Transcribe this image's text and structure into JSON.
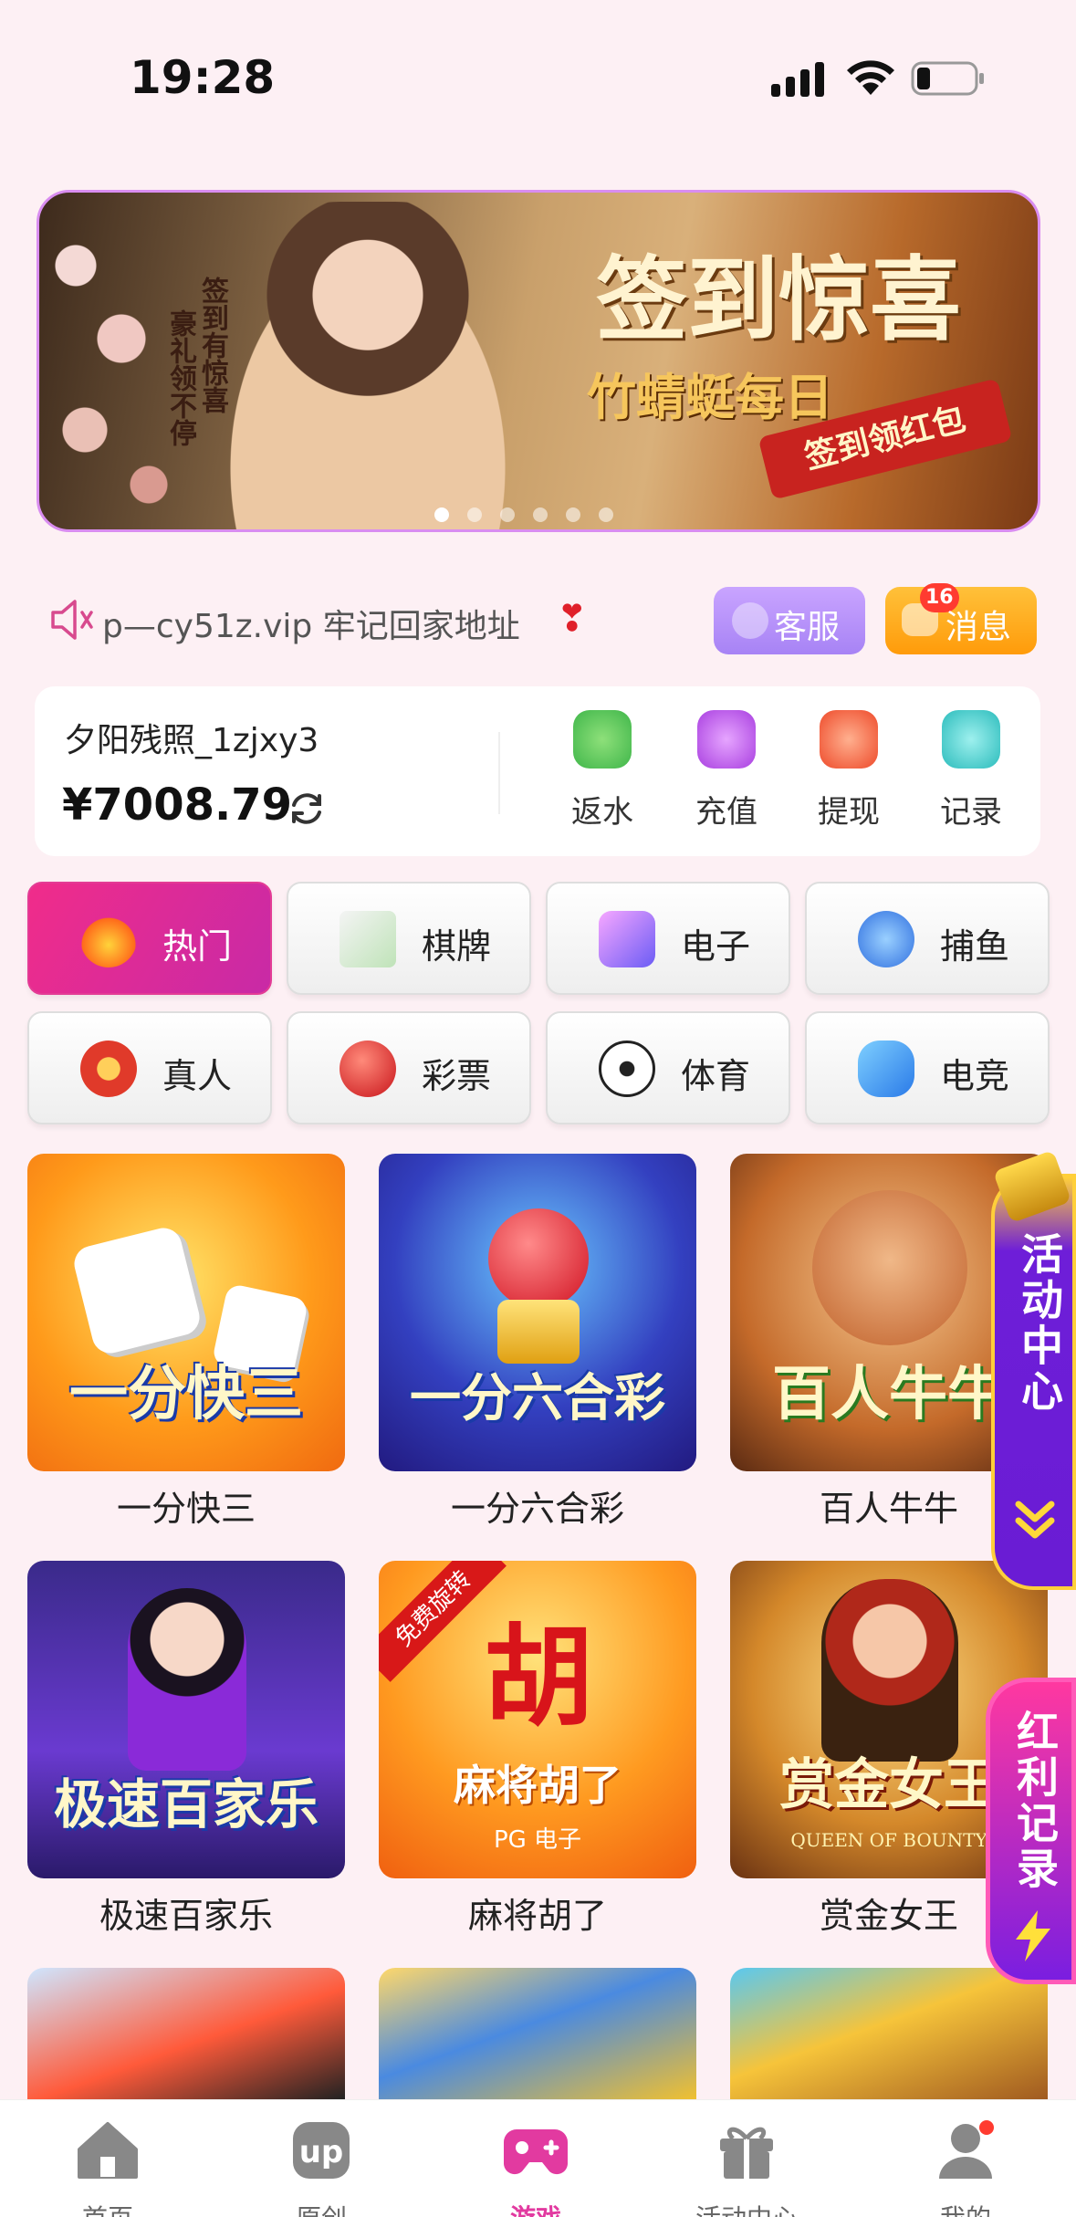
{
  "status_bar": {
    "time": "19:28"
  },
  "banner": {
    "headline": "签到惊喜",
    "subline": "竹蜻蜓每日",
    "ribbon": "签到领红包",
    "vertical_1": "签到有惊喜",
    "vertical_2": "豪礼领不停",
    "slides": 6,
    "active_slide": 1
  },
  "notice": {
    "text": "p—cy51z.vip 牢记回家地址",
    "icon": "speaker-icon"
  },
  "buttons": {
    "service": "客服",
    "messages": "消息",
    "message_badge": "16"
  },
  "account": {
    "username": "夕阳残照_1zjxy3",
    "balance": "¥7008.79",
    "actions": [
      {
        "label": "返水",
        "icon": "coins-icon",
        "color": "#4cc25a"
      },
      {
        "label": "充值",
        "icon": "money-bag-icon",
        "color": "#b44be6"
      },
      {
        "label": "提现",
        "icon": "wallet-icon",
        "color": "#f0522e"
      },
      {
        "label": "记录",
        "icon": "record-icon",
        "color": "#30c1c0"
      }
    ]
  },
  "categories": [
    {
      "label": "热门",
      "icon": "fire-icon",
      "active": true
    },
    {
      "label": "棋牌",
      "icon": "mahjong-icon",
      "active": false
    },
    {
      "label": "电子",
      "icon": "slot-icon",
      "active": false
    },
    {
      "label": "捕鱼",
      "icon": "fish-icon",
      "active": false
    },
    {
      "label": "真人",
      "icon": "chip-icon",
      "active": false
    },
    {
      "label": "彩票",
      "icon": "lottery-ball-icon",
      "active": false
    },
    {
      "label": "体育",
      "icon": "soccer-ball-icon",
      "active": false
    },
    {
      "label": "电竞",
      "icon": "gamepad-icon",
      "active": false
    }
  ],
  "games": [
    {
      "name": "一分快三",
      "art_text": "一分快三"
    },
    {
      "name": "一分六合彩",
      "art_text": "一分六合彩"
    },
    {
      "name": "百人牛牛",
      "art_text": "百人牛牛"
    },
    {
      "name": "极速百家乐",
      "art_text": "极速百家乐"
    },
    {
      "name": "麻将胡了",
      "art_text": "麻将胡了",
      "art_sub": "PG 电子",
      "art_tag": "免费旋转",
      "art_big": "胡"
    },
    {
      "name": "赏金女王",
      "art_text": "赏金女王",
      "art_sub": "QUEEN OF BOUNTY"
    }
  ],
  "floats": {
    "activity": "活动中心",
    "redpacket": "红利记录"
  },
  "tabbar": [
    {
      "label": "首页",
      "icon": "home-icon",
      "active": false
    },
    {
      "label": "原创",
      "icon": "up-icon",
      "active": false
    },
    {
      "label": "游戏",
      "icon": "gamepad-icon",
      "active": true
    },
    {
      "label": "活动中心",
      "icon": "gift-icon",
      "active": false
    },
    {
      "label": "我的",
      "icon": "user-icon",
      "active": false
    }
  ],
  "colors": {
    "accent": "#e23aa0",
    "background": "#fdf0f4"
  }
}
